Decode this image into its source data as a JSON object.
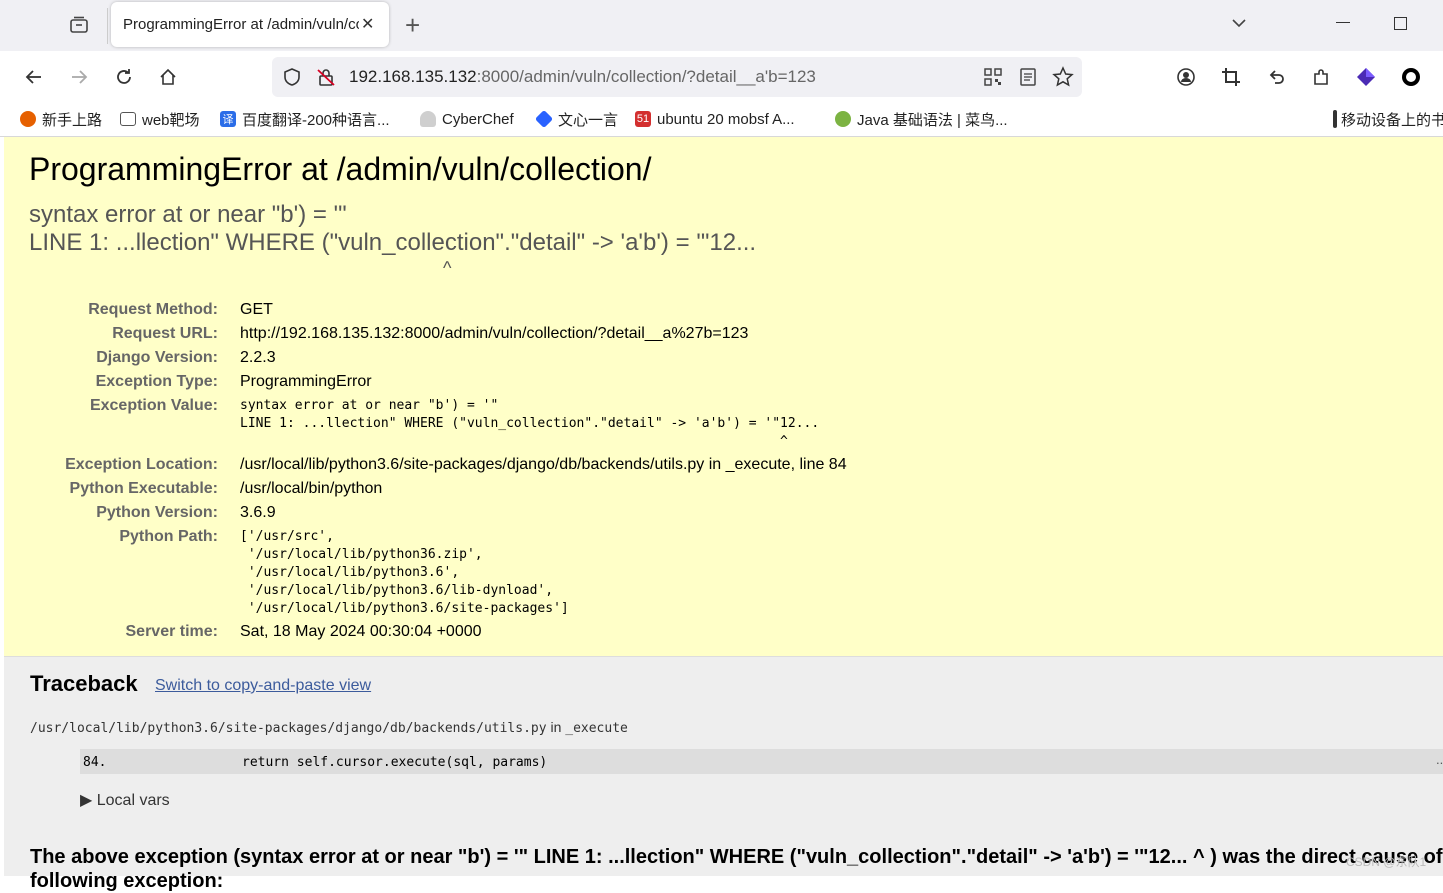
{
  "browser": {
    "tab_title": "ProgrammingError at /admin/vuln/collection/",
    "tab_close": "✕",
    "new_tab": "+",
    "tab_list": "⌄",
    "minimize": "—",
    "maximize": "☐",
    "url_host": "192.168.135.132",
    "url_rest": ":8000/admin/vuln/collection/?detail__a'b=123"
  },
  "bookmarks": [
    {
      "label": "新手上路",
      "icon": "firefox-icon",
      "color": "#e66000"
    },
    {
      "label": "web靶场",
      "icon": "folder-icon",
      "color": "#555555"
    },
    {
      "label": "百度翻译-200种语言...",
      "icon": "translate-icon",
      "color": "#2b6de8"
    },
    {
      "label": "CyberChef",
      "icon": "chef-icon",
      "color": "#9e9e9e"
    },
    {
      "label": "文心一言",
      "icon": "wenxin-icon",
      "color": "#2962ff"
    },
    {
      "label": "ubuntu 20 mobsf A...",
      "icon": "51cto-icon",
      "color": "#d32f2f"
    },
    {
      "label": "Java 基础语法 | 菜鸟...",
      "icon": "runoob-icon",
      "color": "#7cb342"
    }
  ],
  "mobile_bookmarks": "移动设备上的书签",
  "error": {
    "title": "ProgrammingError at /admin/vuln/collection/",
    "subtitle_line1": "syntax error at or near \"b') = '\"",
    "subtitle_line2": "LINE 1: ...llection\" WHERE (\"vuln_collection\".\"detail\" -> 'a'b') = '\"12...",
    "subtitle_line3": "                                                                           ^"
  },
  "meta": {
    "request_method_label": "Request Method:",
    "request_method": "GET",
    "request_url_label": "Request URL:",
    "request_url": "http://192.168.135.132:8000/admin/vuln/collection/?detail__a%27b=123",
    "django_version_label": "Django Version:",
    "django_version": "2.2.3",
    "exception_type_label": "Exception Type:",
    "exception_type": "ProgrammingError",
    "exception_value_label": "Exception Value:",
    "exception_value": "syntax error at or near \"b') = '\"\nLINE 1: ...llection\" WHERE (\"vuln_collection\".\"detail\" -> 'a'b') = '\"12...\n                                                                     ^",
    "exception_location_label": "Exception Location:",
    "exception_location": "/usr/local/lib/python3.6/site-packages/django/db/backends/utils.py in _execute, line 84",
    "python_executable_label": "Python Executable:",
    "python_executable": "/usr/local/bin/python",
    "python_version_label": "Python Version:",
    "python_version": "3.6.9",
    "python_path_label": "Python Path:",
    "python_path": "['/usr/src',\n '/usr/local/lib/python36.zip',\n '/usr/local/lib/python3.6',\n '/usr/local/lib/python3.6/lib-dynload',\n '/usr/local/lib/python3.6/site-packages']",
    "server_time_label": "Server time:",
    "server_time": "Sat, 18 May 2024 00:30:04 +0000"
  },
  "traceback": {
    "heading": "Traceback",
    "switch_link": "Switch to copy-and-paste view",
    "file_path": "/usr/local/lib/python3.6/site-packages/django/db/backends/utils.py",
    "file_in": " in ",
    "function": "_execute",
    "line_no": "84.",
    "code": "return self.cursor.execute(sql, params)",
    "dots": "...",
    "local_vars": "▶ Local vars",
    "cause_line1": "The above exception (syntax error at or near \"b') = '\" LINE 1: ...llection\" WHERE (\"vuln_collection\".\"detail\" -> 'a'b') = '\"12... ^ ) was the direct cause of the",
    "cause_line2": "following exception:"
  },
  "watermark": "CSDN @东队1"
}
